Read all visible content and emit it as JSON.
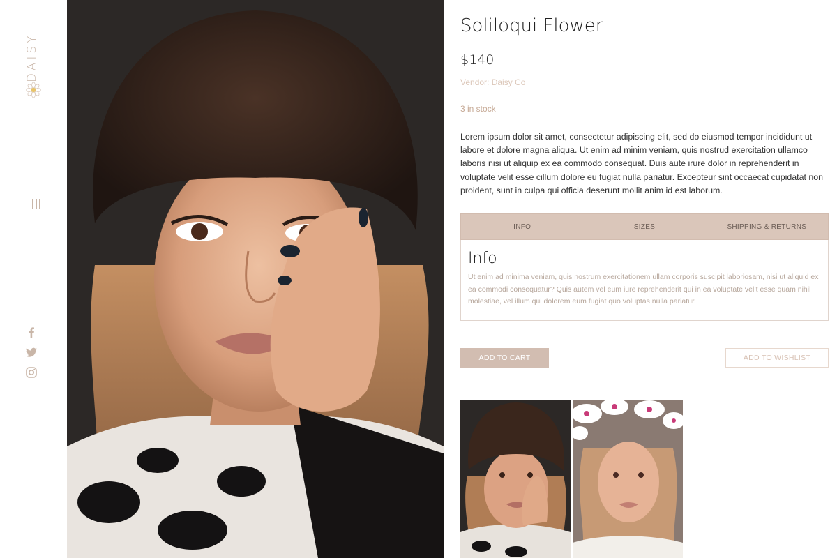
{
  "brand": {
    "logo_text": "DAISY"
  },
  "sidebar": {
    "menu_icon": "hamburger-icon",
    "social": [
      {
        "name": "facebook-icon"
      },
      {
        "name": "twitter-icon"
      },
      {
        "name": "instagram-icon"
      }
    ]
  },
  "product": {
    "title": "Soliloqui Flower",
    "price": "$140",
    "vendor": "Vendor: Daisy Co",
    "stock": "3 in stock",
    "description": "Lorem ipsum dolor sit amet, consectetur adipiscing elit, sed do eiusmod tempor incididunt ut labore et dolore magna aliqua. Ut enim ad minim veniam, quis nostrud exercitation ullamco laboris nisi ut aliquip ex ea commodo consequat. Duis aute irure dolor in reprehenderit in voluptate velit esse cillum dolore eu fugiat nulla pariatur. Excepteur sint occaecat cupidatat non proident, sunt in culpa qui officia deserunt mollit anim id est laborum."
  },
  "tabs": {
    "items": [
      {
        "label": "INFO"
      },
      {
        "label": "SIZES"
      },
      {
        "label": "SHIPPING & RETURNS"
      }
    ],
    "active_heading": "Info",
    "active_text": "Ut enim ad minima veniam, quis nostrum exercitationem ullam corporis suscipit laboriosam, nisi ut aliquid ex ea commodi consequatur? Quis autem vel eum iure reprehenderit qui in ea voluptate velit esse quam nihil molestiae, vel illum qui dolorem eum fugiat quo voluptas nulla pariatur."
  },
  "actions": {
    "add_to_cart": "ADD TO CART",
    "add_to_wishlist": "ADD TO WISHLIST"
  },
  "colors": {
    "accent": "#d2bdb1",
    "tab_bar": "#dac6ba",
    "muted_text": "#c6a995"
  }
}
